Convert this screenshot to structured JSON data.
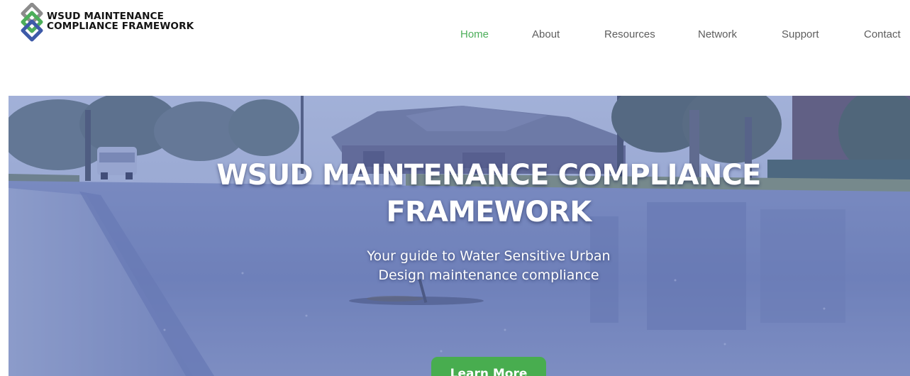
{
  "brand": {
    "name_line1": "WSUD MAINTENANCE",
    "name_line2": "COMPLIANCE FRAMEWORK",
    "logo_icon": "interlocking-diamonds-logo",
    "colors": {
      "grey": "#8c8c8c",
      "green": "#4cae5a",
      "blue": "#3d5aa8"
    }
  },
  "nav": {
    "items": [
      {
        "label": "Home",
        "active": true
      },
      {
        "label": "About",
        "active": false
      },
      {
        "label": "Resources",
        "active": false
      },
      {
        "label": "Network",
        "active": false
      },
      {
        "label": "Support",
        "active": false
      },
      {
        "label": "Contact",
        "active": false
      }
    ],
    "active_color": "#4cae5a",
    "text_color": "#5e5e5e"
  },
  "hero": {
    "title_line1": "WSUD MAINTENANCE COMPLIANCE",
    "title_line2": "FRAMEWORK",
    "subtitle_line1": "Your guide to Water Sensitive Urban",
    "subtitle_line2": "Design maintenance compliance",
    "cta_label": "Learn More",
    "cta_color": "#48ad4f",
    "overlay_color": "#4862b2"
  }
}
